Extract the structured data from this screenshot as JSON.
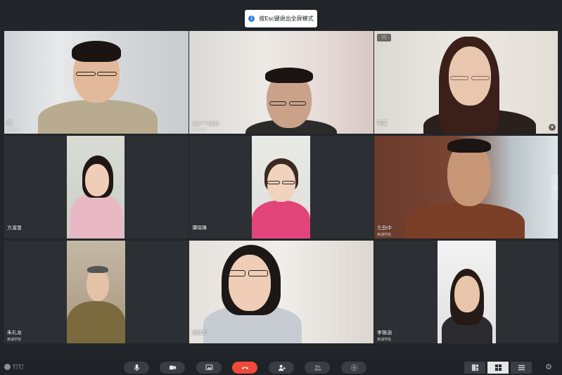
{
  "toast": {
    "text": "按Esc键退出全屏模式"
  },
  "participants": [
    {
      "name": "我",
      "org": "黄湖学院"
    },
    {
      "name": "189****9030",
      "org": "黄湖学院"
    },
    {
      "name": "周蕾",
      "org": ""
    },
    {
      "name": "方淑苗",
      "org": ""
    },
    {
      "name": "谭晓琳",
      "org": ""
    },
    {
      "name": "左劲中",
      "org": "黄湖学院"
    },
    {
      "name": "朱礼龙",
      "org": "黄湖学院"
    },
    {
      "name": "胡佳芳",
      "org": ""
    },
    {
      "name": "李璐涵",
      "org": "黄湖学院"
    }
  ],
  "toolbar": {
    "brand": "钉钉",
    "buttons": [
      "microphone-icon",
      "camera-icon",
      "screen-share-icon",
      "hang-up-icon",
      "add-member-icon",
      "members-icon",
      "record-icon"
    ],
    "layouts": [
      "speaker-layout-icon",
      "grid-layout-icon",
      "list-layout-icon"
    ],
    "settings": "gear-icon"
  },
  "colors": {
    "hangup": "#f04a3a",
    "toolbar": "#1f2226",
    "tile": "#2c2f33"
  }
}
